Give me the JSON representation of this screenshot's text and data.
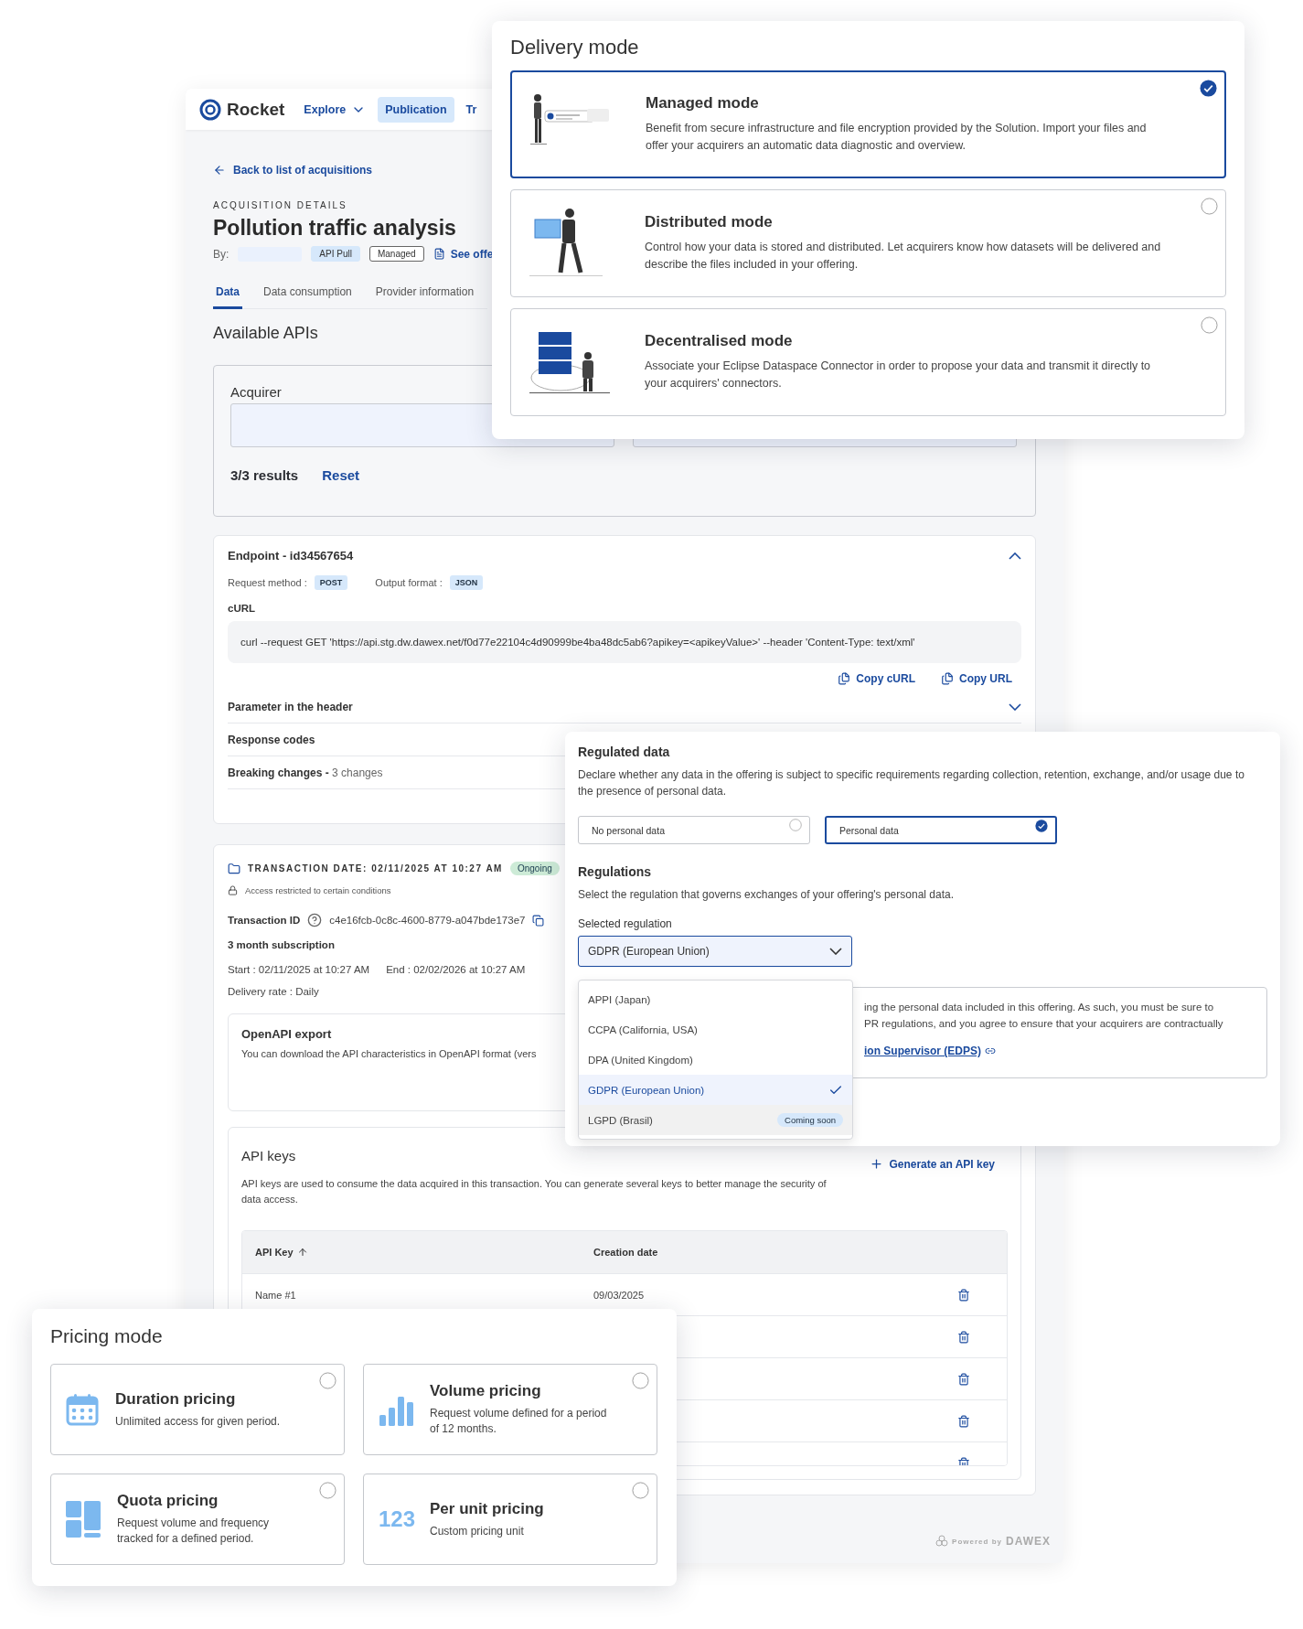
{
  "app": {
    "brand": "Rocket",
    "nav": [
      {
        "label": "Explore",
        "kind": "dropdown",
        "selected": false
      },
      {
        "label": "Publication",
        "kind": "link",
        "selected": true
      },
      {
        "label": "Tr",
        "kind": "link",
        "selected": false
      }
    ],
    "back_link": "Back to list of acquisitions",
    "eyebrow": "ACQUISITION DETAILS",
    "title": "Pollution traffic analysis",
    "by_label": "By:",
    "badges": [
      {
        "label": "API Pull",
        "kind": "filled"
      },
      {
        "label": "Managed",
        "kind": "outline"
      }
    ],
    "offer_link": "See offe",
    "tabs": [
      {
        "label": "Data",
        "selected": true
      },
      {
        "label": "Data consumption",
        "selected": false
      },
      {
        "label": "Provider information",
        "selected": false
      }
    ],
    "section_title": "Available APIs",
    "filter": {
      "label": "Acquirer",
      "results": "3/3 results",
      "reset": "Reset"
    },
    "endpoint": {
      "title": "Endpoint - id34567654",
      "expanded": true,
      "method_label": "Request method :",
      "method": "POST",
      "format_label": "Output format :",
      "format": "JSON",
      "curl_label": "cURL",
      "curl": "curl --request GET 'https://api.stg.dw.dawex.net/f0d77e22104c4d90999be4ba48dc5ab6?apikey=<apikeyValue>' --header 'Content-Type: text/xml'",
      "actions": [
        "Copy cURL",
        "Copy URL"
      ],
      "sections": [
        {
          "title": "Parameter in the header",
          "expanded": false
        },
        {
          "title": "Response codes"
        },
        {
          "title": "Breaking changes -",
          "note": "3 changes"
        }
      ]
    },
    "transaction": {
      "date": "TRANSACTION DATE: 02/11/2025 AT 10:27 AM",
      "status": "Ongoing",
      "access": "Access restricted to certain conditions",
      "id_label": "Transaction ID",
      "id": "c4e16fcb-0c8c-4600-8779-a047bde173e7",
      "subscription": "3 month subscription",
      "start": "Start : 02/11/2025 at 10:27 AM",
      "end": "End : 02/02/2026 at 10:27 AM",
      "delivery_rate": "Delivery rate : Daily"
    },
    "openapi": {
      "title": "OpenAPI export",
      "text": "You can download the API characteristics in OpenAPI format (vers"
    },
    "api_keys": {
      "title": "API keys",
      "description": "API keys are used to consume the data acquired in this transaction. You can generate several keys to better manage the security of data access.",
      "generate": "Generate an API key",
      "columns": [
        "API Key",
        "Creation date"
      ],
      "rows": [
        {
          "name": "Name #1",
          "date": "09/03/2025"
        },
        {},
        {},
        {},
        {}
      ]
    },
    "footer": {
      "powered": "Powered by",
      "brand": "DAWEX"
    }
  },
  "delivery": {
    "title": "Delivery mode",
    "options": [
      {
        "kind": "managed",
        "title": "Managed mode",
        "text": "Benefit from secure infrastructure and file encryption provided by the Solution. Import your files and offer your acquirers an automatic data diagnostic and overview.",
        "selected": true
      },
      {
        "kind": "distributed",
        "title": "Distributed mode",
        "text": "Control how your data is stored and distributed. Let acquirers know how datasets will be delivered and describe the files included in your offering.",
        "selected": false
      },
      {
        "kind": "decentralised",
        "title": "Decentralised mode",
        "text": "Associate your Eclipse Dataspace Connector in order to propose your data and transmit it directly to your acquirers' connectors.",
        "selected": false
      }
    ]
  },
  "regulated": {
    "title": "Regulated data",
    "description": "Declare whether any data in the offering is subject to specific requirements regarding collection, retention, exchange, and/or usage due to the presence of personal data.",
    "choices": [
      {
        "label": "No personal data",
        "selected": false
      },
      {
        "label": "Personal data",
        "selected": true
      }
    ],
    "regulations_title": "Regulations",
    "regulations_text": "Select the regulation that governs exchanges of your offering's personal data.",
    "select_label": "Selected regulation",
    "select_value": "GDPR (European Union)",
    "expanded": true,
    "options": [
      {
        "label": "APPI (Japan)",
        "selected": false,
        "disabled": false
      },
      {
        "label": "CCPA (California, USA)",
        "selected": false,
        "disabled": false
      },
      {
        "label": "DPA (United Kingdom)",
        "selected": false,
        "disabled": false
      },
      {
        "label": "GDPR (European Union)",
        "selected": true,
        "disabled": false
      },
      {
        "label": "LGPD (Brasil)",
        "selected": false,
        "disabled": true,
        "badge": "Coming soon"
      }
    ],
    "notice_lines": [
      "ing the personal data included in this offering. As such, you must be sure to",
      "PR regulations, and you agree to ensure that your acquirers are contractually"
    ],
    "notice_link": "ion Supervisor (EDPS)"
  },
  "pricing": {
    "title": "Pricing mode",
    "options": [
      {
        "kind": "duration",
        "title": "Duration pricing",
        "text": "Unlimited access for given period.",
        "selected": false
      },
      {
        "kind": "volume",
        "title": "Volume pricing",
        "text": "Request volume defined for a period of 12 months.",
        "selected": false
      },
      {
        "kind": "quota",
        "title": "Quota pricing",
        "text": "Request volume and frequency tracked for a defined period.",
        "selected": false
      },
      {
        "kind": "unit",
        "title": "Per unit pricing",
        "text": "Custom pricing unit",
        "icon_text": "123",
        "selected": false
      }
    ]
  }
}
